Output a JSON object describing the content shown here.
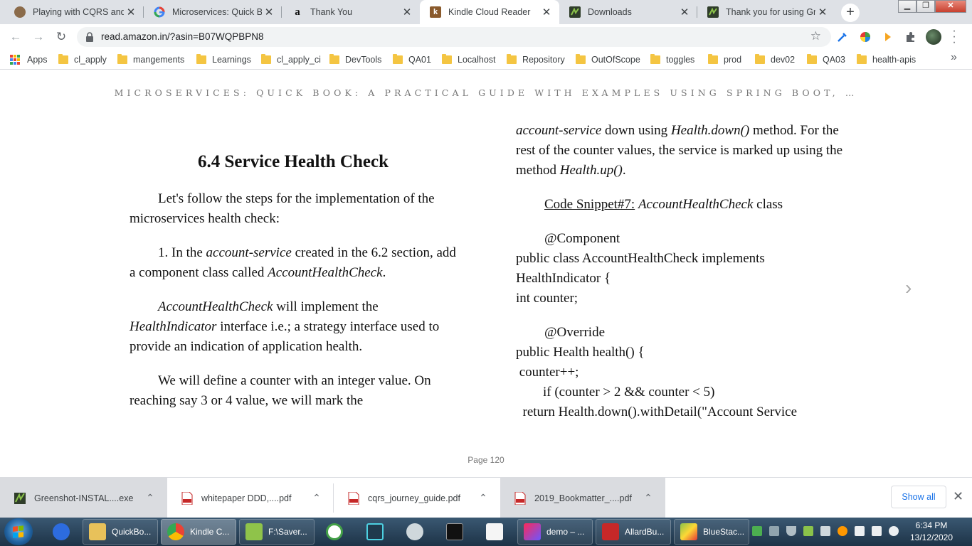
{
  "browser": {
    "tabs": [
      {
        "title": "Playing with CQRS and E",
        "favicon": "avatar-icon",
        "active": false
      },
      {
        "title": "Microservices: Quick Boo",
        "favicon": "google-icon",
        "active": false
      },
      {
        "title": "Thank You",
        "favicon": "amazon-icon",
        "active": false
      },
      {
        "title": "Kindle Cloud Reader",
        "favicon": "kindle-icon",
        "active": true
      },
      {
        "title": "Downloads",
        "favicon": "greenshot-icon",
        "active": false
      },
      {
        "title": "Thank you for using Gree",
        "favicon": "greenshot-icon",
        "active": false
      }
    ],
    "new_tab_label": "+",
    "address": "read.amazon.in/?asin=B07WQPBPN8",
    "bookmarks": [
      "Apps",
      "cl_apply",
      "mangements",
      "Learnings",
      "cl_apply_ci",
      "DevTools",
      "QA01",
      "Localhost",
      "Repository",
      "OutOfScope",
      "toggles",
      "prod",
      "dev02",
      "QA03",
      "health-apis"
    ]
  },
  "reader": {
    "book_title": "MICROSERVICES: QUICK BOOK: A PRACTICAL GUIDE WITH EXAMPLES USING SPRING BOOT, …",
    "heading": "6.4 Service Health Check",
    "left": {
      "p1": "Let's follow the steps for the implementation of the microservices health check:",
      "p2_a": "1. In the ",
      "p2_b": "account-service",
      "p2_c": " created in the 6.2 section, add a component class called ",
      "p2_d": "AccountHealthCheck",
      "p2_e": ".",
      "p3_a": "AccountHealthCheck",
      "p3_b": " will implement the ",
      "p3_c": "HealthIndicator",
      "p3_d": " interface i.e.; a strategy interface used to provide an indication of application health.",
      "p4": "We will define a counter with an integer value. On reaching say 3 or 4 value, we will mark the"
    },
    "right": {
      "p1_a": "account-service",
      "p1_b": " down using ",
      "p1_c": "Health.down()",
      "p1_d": " method. For the rest of the counter values, the service is marked up using the method ",
      "p1_e": "Health.up()",
      "p1_f": ".",
      "snippet_label": "Code Snippet#7:",
      "snippet_class": "AccountHealthCheck",
      "snippet_suffix": " class",
      "code1": [
        "@Component",
        "public class AccountHealthCheck implements",
        "HealthIndicator {",
        "int counter;"
      ],
      "code2": [
        "@Override",
        "public Health health() {",
        " counter++;",
        "        if (counter > 2 && counter < 5)",
        "  return Health.down().withDetail(\"Account Service"
      ]
    },
    "page_label": "Page 120"
  },
  "downloads": {
    "items": [
      {
        "name": "Greenshot-INSTAL....exe",
        "type": "exe"
      },
      {
        "name": "whitepaper DDD,....pdf",
        "type": "pdf"
      },
      {
        "name": "cqrs_journey_guide.pdf",
        "type": "pdf"
      },
      {
        "name": "2019_Bookmatter_....pdf",
        "type": "pdf"
      }
    ],
    "show_all": "Show all"
  },
  "taskbar": {
    "items": [
      {
        "label": "",
        "icon": "pinned-app-icon"
      },
      {
        "label": "QuickBo...",
        "icon": "folder-icon"
      },
      {
        "label": "Kindle C...",
        "icon": "chrome-icon"
      },
      {
        "label": "F:\\Saver...",
        "icon": "notepad-icon"
      },
      {
        "label": "",
        "icon": "clock-app-icon"
      },
      {
        "label": "",
        "icon": "editor-icon"
      },
      {
        "label": "",
        "icon": "snipping-icon"
      },
      {
        "label": "",
        "icon": "cmd-icon"
      },
      {
        "label": "",
        "icon": "java-icon"
      },
      {
        "label": "demo – ...",
        "icon": "intellij-icon"
      },
      {
        "label": "AllardBu...",
        "icon": "pdf-icon"
      },
      {
        "label": "BlueStac...",
        "icon": "bluestacks-icon"
      }
    ],
    "time": "6:34 PM",
    "date": "13/12/2020"
  }
}
